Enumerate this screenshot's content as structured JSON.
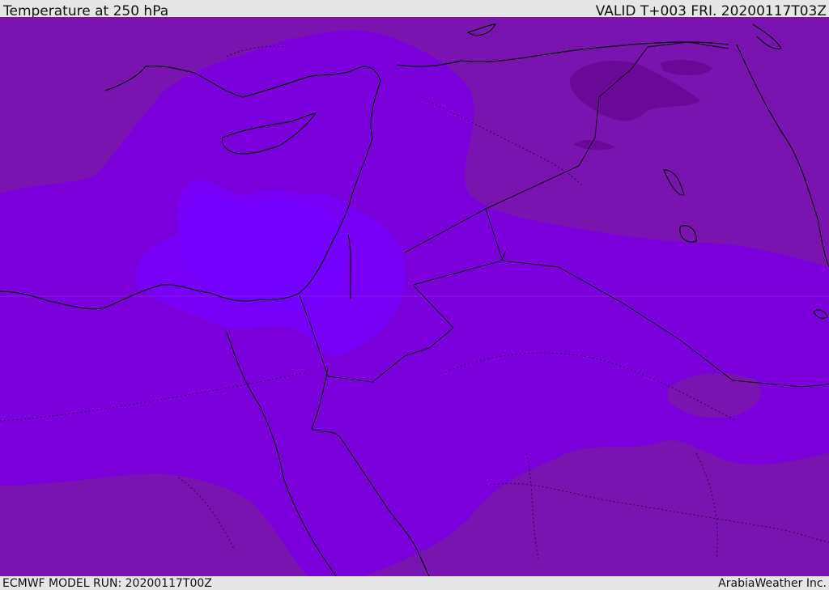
{
  "header": {
    "title": "Temperature at 250 hPa",
    "valid": "VALID T+003 FRI. 20200117T03Z"
  },
  "footer": {
    "model_run": "ECMWF MODEL RUN: 20200117T00Z",
    "credit": "ArabiaWeather Inc."
  },
  "colors": {
    "warmest": "#7a14b0",
    "mid": "#7c00dc",
    "cool": "#7800f6",
    "coolest": "#7400ff",
    "cold_core": "#6a0898",
    "coastline": "#000000"
  }
}
